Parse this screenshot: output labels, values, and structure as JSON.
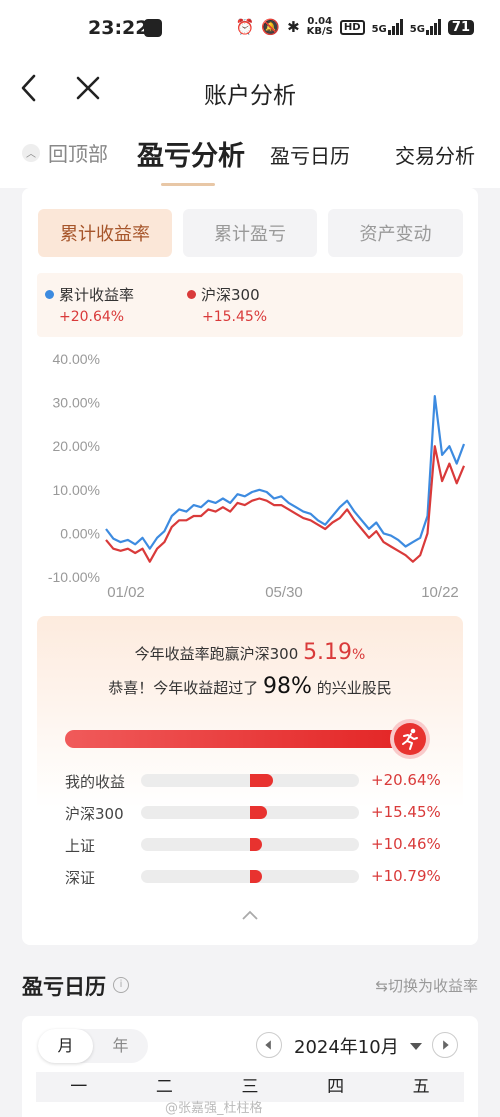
{
  "status_bar": {
    "time": "23:22",
    "net_speed": "0.04",
    "net_unit": "KB/S",
    "hd_label": "HD",
    "signal1": "5G",
    "signal2": "5G",
    "battery": "71"
  },
  "nav": {
    "title": "账户分析",
    "back_icon": "chevron-left-icon",
    "close_icon": "close-icon"
  },
  "tabs": {
    "back_to_top": "回顶部",
    "items": [
      {
        "label": "盈亏分析",
        "active": true
      },
      {
        "label": "盈亏日历",
        "active": false
      },
      {
        "label": "交易分析",
        "active": false
      }
    ]
  },
  "segments": [
    {
      "label": "累计收益率",
      "active": true
    },
    {
      "label": "累计盈亏",
      "active": false
    },
    {
      "label": "资产变动",
      "active": false
    }
  ],
  "legend": {
    "items": [
      {
        "label": "累计收益率",
        "value": "+20.64%",
        "color": "#3d8be0"
      },
      {
        "label": "沪深300",
        "value": "+15.45%",
        "color": "#d93a3a"
      }
    ]
  },
  "chart_data": {
    "type": "line",
    "y_ticks": [
      "40.00%",
      "30.00%",
      "20.00%",
      "10.00%",
      "0.00%",
      "-10.00%"
    ],
    "ylim": [
      -10,
      40
    ],
    "x_ticks": [
      "01/02",
      "05/30",
      "10/22"
    ],
    "grid": false,
    "series": [
      {
        "name": "累计收益率",
        "color": "#3d8be0",
        "values": [
          1,
          -1.2,
          -2,
          -1.5,
          -2.5,
          -1,
          -3.5,
          -1,
          0.5,
          4,
          5.5,
          5,
          6.5,
          6,
          7.5,
          7,
          8,
          7,
          9,
          8.5,
          9.5,
          10,
          9.5,
          8,
          8.5,
          7,
          6,
          5,
          4.5,
          3,
          2,
          4,
          6,
          7.5,
          5,
          3,
          1,
          2.5,
          0,
          -0.5,
          -1.5,
          -3,
          -2,
          -1,
          4,
          31.5,
          18,
          20,
          16,
          20.5
        ]
      },
      {
        "name": "沪深300",
        "color": "#d93a3a",
        "values": [
          -1.5,
          -3.5,
          -4,
          -3.5,
          -4.5,
          -3.5,
          -6.5,
          -3.5,
          -2,
          1.5,
          3,
          3,
          4,
          4,
          5.5,
          5,
          6,
          5,
          7,
          6.5,
          7.5,
          8,
          7.5,
          6.5,
          6.5,
          5.5,
          4.5,
          3.5,
          3,
          2,
          1,
          2.5,
          3.5,
          5.5,
          3,
          1,
          -1,
          0.5,
          -2,
          -3,
          -4,
          -5,
          -6.5,
          -5,
          0,
          20,
          12,
          16,
          11.5,
          15.5
        ]
      }
    ]
  },
  "summary": {
    "line1_prefix": "今年收益率跑赢沪深300",
    "line1_value": "5.19",
    "line1_unit": "%",
    "line2_prefix": "恭喜！今年收益超过了",
    "line2_value": "98%",
    "line2_suffix": "的兴业股民",
    "progress_fraction": 0.98,
    "comparisons": [
      {
        "label": "我的收益",
        "value": "+20.64%",
        "percent": 20.64
      },
      {
        "label": "沪深300",
        "value": "+15.45%",
        "percent": 15.45
      },
      {
        "label": "上证",
        "value": "+10.46%",
        "percent": 10.46
      },
      {
        "label": "深证",
        "value": "+10.79%",
        "percent": 10.79
      }
    ]
  },
  "calendar": {
    "title": "盈亏日历",
    "switch_label": "⇆切换为收益率",
    "toggle": [
      {
        "label": "月",
        "active": true
      },
      {
        "label": "年",
        "active": false
      }
    ],
    "month_label": "2024年10月",
    "weekdays": [
      "一",
      "二",
      "三",
      "四",
      "五"
    ]
  },
  "watermark": "@张嘉强_杜柱格"
}
